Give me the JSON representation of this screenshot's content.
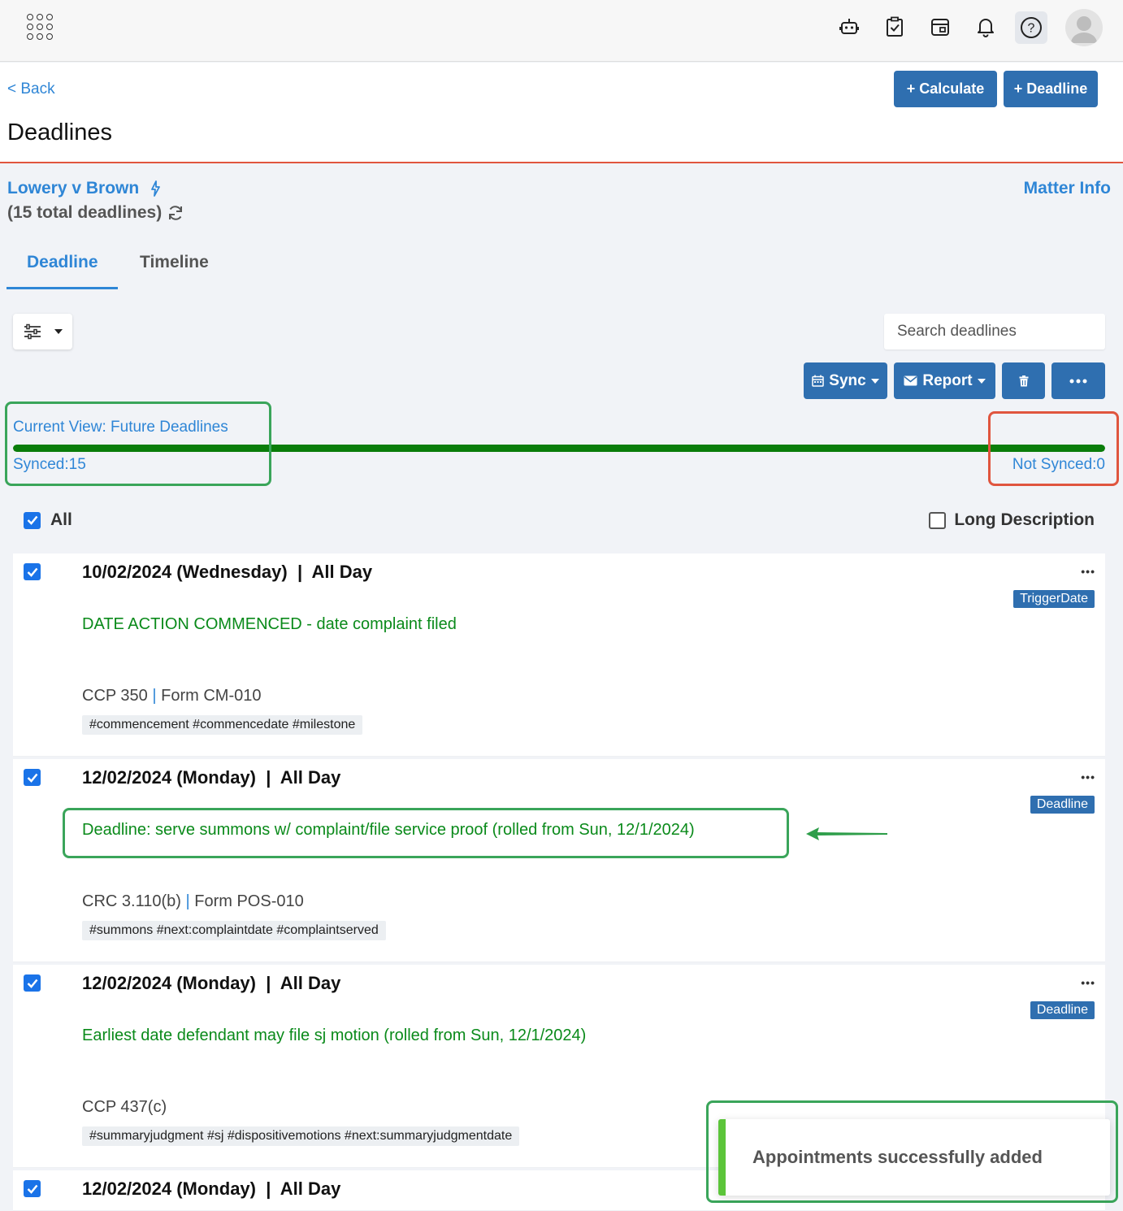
{
  "header": {
    "back_label": "< Back",
    "page_title": "Deadlines",
    "calculate_label": "+ Calculate",
    "deadline_label": "+ Deadline"
  },
  "matter": {
    "name": "Lowery v Brown",
    "total_deadlines": "(15 total deadlines)",
    "info_label": "Matter Info"
  },
  "tabs": [
    {
      "label": "Deadline",
      "active": true
    },
    {
      "label": "Timeline",
      "active": false
    }
  ],
  "search": {
    "placeholder": "Search deadlines"
  },
  "toolbar": {
    "sync_label": "Sync",
    "report_label": "Report"
  },
  "sync_status": {
    "view_label": "Current View: Future Deadlines",
    "synced_label": "Synced:15",
    "not_synced_label": "Not Synced:0",
    "synced_fraction": 1.0
  },
  "list_controls": {
    "all_label": "All",
    "all_checked": true,
    "long_description_label": "Long Description",
    "long_description_checked": false
  },
  "deadlines": [
    {
      "date": "10/02/2024 (Wednesday)  |  All Day",
      "title": "DATE ACTION COMMENCED - date complaint filed",
      "rule": "CCP 350",
      "form": "Form CM-010",
      "tags": "#commencement #commencedate #milestone",
      "badge": "TriggerDate",
      "more": "•••"
    },
    {
      "date": "12/02/2024 (Monday)  |  All Day",
      "title": "Deadline: serve summons w/ complaint/file service proof (rolled from Sun, 12/1/2024)",
      "rule": "CRC 3.110(b)",
      "form": "Form POS-010",
      "tags": "#summons #next:complaintdate #complaintserved",
      "badge": "Deadline",
      "more": "•••"
    },
    {
      "date": "12/02/2024 (Monday)  |  All Day",
      "title": "Earliest date defendant may file sj motion (rolled from Sun, 12/1/2024)",
      "rule": "CCP 437(c)",
      "form": "",
      "tags": "#summaryjudgment #sj #dispositivemotions #next:summaryjudgmentdate",
      "badge": "Deadline",
      "more": "•••"
    },
    {
      "date": "12/02/2024 (Monday)  |  All Day"
    }
  ],
  "toast": {
    "message": "Appointments successfully added"
  },
  "colors": {
    "primary_button": "#2f6fb0",
    "link": "#2f86d6",
    "deadline_title": "#0a8a1a",
    "progress": "#0a7d0a",
    "header_rule": "#e0553e",
    "annotation_green": "#3aa55a",
    "annotation_red": "#e0553e",
    "toast_accent": "#5cc53a"
  },
  "icons": [
    "apps-grid-icon",
    "robot-icon",
    "clipboard-check-icon",
    "calendar-icon",
    "bell-icon",
    "help-icon",
    "user-avatar-icon",
    "lightning-icon",
    "refresh-icon",
    "sliders-icon",
    "calendar-small-icon",
    "envelope-icon",
    "trash-icon",
    "ellipsis-icon",
    "checkmark-icon",
    "arrow-left-icon"
  ]
}
